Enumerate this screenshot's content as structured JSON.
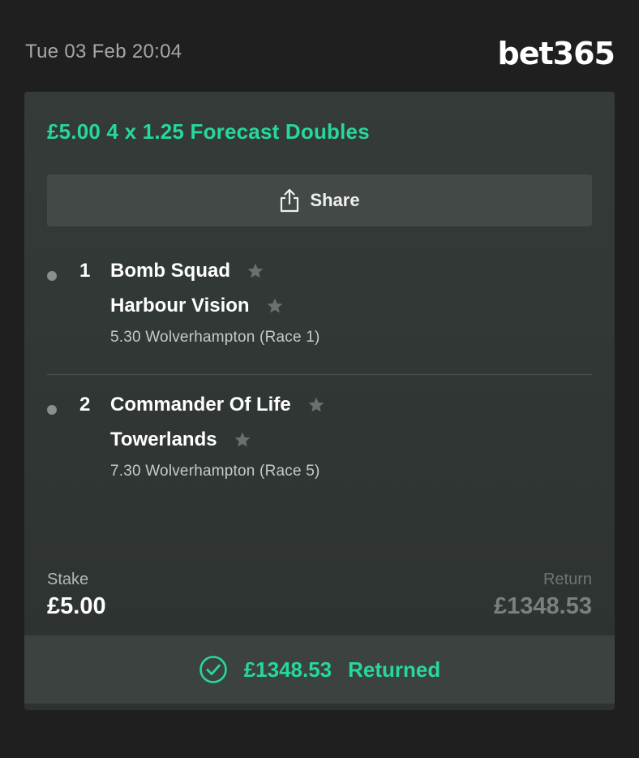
{
  "header": {
    "timestamp": "Tue 03 Feb 20:04",
    "logo_text": "bet365"
  },
  "bet": {
    "title": "£5.00 4 x 1.25 Forecast Doubles",
    "share_label": "Share",
    "selections": [
      {
        "number": "1",
        "runners": [
          "Bomb Squad",
          "Harbour Vision"
        ],
        "race": "5.30 Wolverhampton (Race 1)"
      },
      {
        "number": "2",
        "runners": [
          "Commander Of Life",
          "Towerlands"
        ],
        "race": "7.30 Wolverhampton (Race 5)"
      }
    ],
    "stake_label": "Stake",
    "stake_value": "£5.00",
    "return_label": "Return",
    "return_value": "£1348.53",
    "returned_amount": "£1348.53",
    "returned_label": "Returned"
  },
  "colors": {
    "accent": "#26d89a",
    "background": "#1f1f1f",
    "card": "#343b38",
    "share_button": "#434947"
  },
  "icons": {
    "share": "share-icon",
    "star": "star-icon",
    "check": "check-circle-icon"
  }
}
